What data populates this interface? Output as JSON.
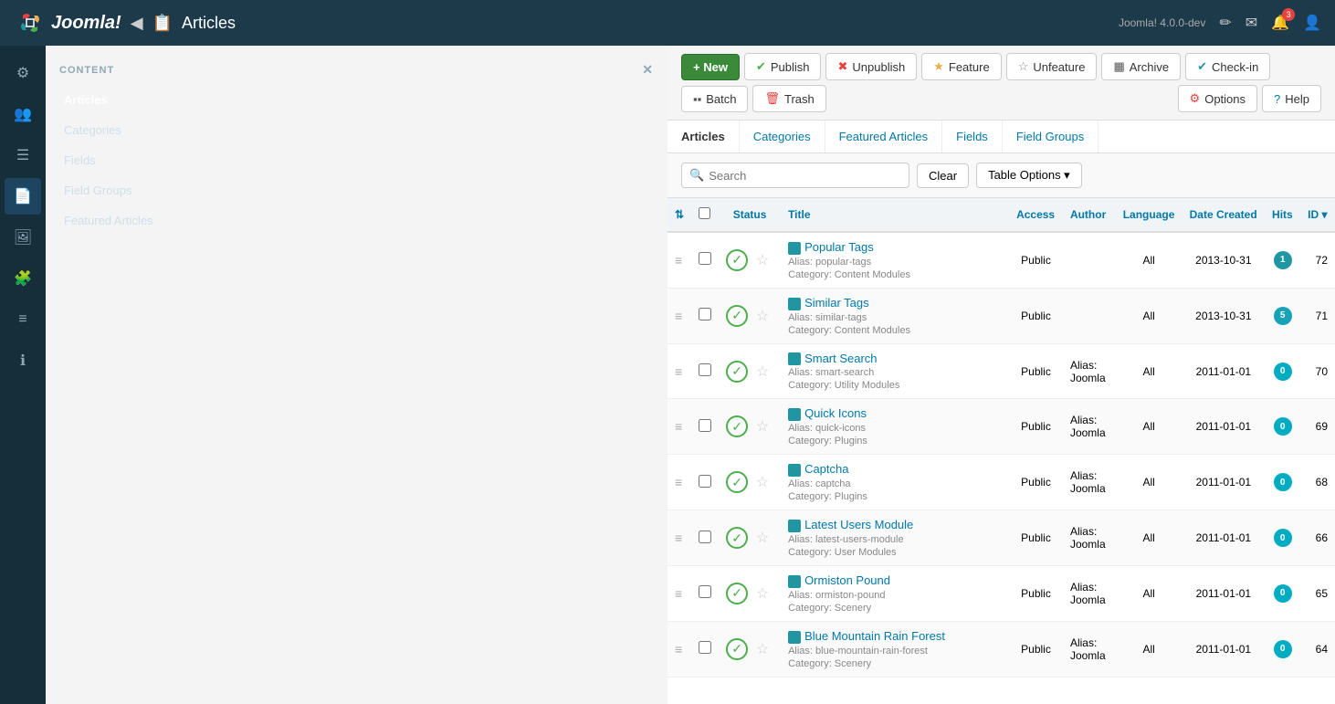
{
  "topbar": {
    "back_label": "◀",
    "page_icon": "📄",
    "title": "Articles",
    "version": "Joomla! 4.0.0-dev",
    "icons": [
      {
        "name": "edit-icon",
        "symbol": "✏"
      },
      {
        "name": "mail-icon",
        "symbol": "✉"
      },
      {
        "name": "bell-icon",
        "symbol": "🔔",
        "badge": "3"
      },
      {
        "name": "user-icon",
        "symbol": "👤"
      }
    ]
  },
  "toolbar": {
    "new_label": "+ New",
    "buttons": [
      {
        "name": "publish-button",
        "icon": "✔",
        "icon_color": "#4cae4c",
        "label": "Publish"
      },
      {
        "name": "unpublish-button",
        "icon": "✖",
        "icon_color": "#e84141",
        "label": "Unpublish"
      },
      {
        "name": "feature-button",
        "icon": "★",
        "icon_color": "#f0ad4e",
        "label": "Feature"
      },
      {
        "name": "unfeature-button",
        "icon": "☆",
        "icon_color": "#888",
        "label": "Unfeature"
      },
      {
        "name": "archive-button",
        "icon": "▦",
        "icon_color": "#888",
        "label": "Archive"
      },
      {
        "name": "checkin-button",
        "icon": "✔",
        "icon_color": "#2196a3",
        "label": "Check-in"
      },
      {
        "name": "batch-button",
        "icon": "▪",
        "icon_color": "#888",
        "label": "Batch"
      },
      {
        "name": "trash-button",
        "icon": "🗑",
        "icon_color": "#e84141",
        "label": "Trash"
      }
    ],
    "options_label": "Options",
    "help_label": "Help"
  },
  "subnav": {
    "items": [
      {
        "name": "articles-link",
        "label": "Articles",
        "active": true
      },
      {
        "name": "categories-link",
        "label": "Categories"
      },
      {
        "name": "featured-articles-link",
        "label": "Featured Articles"
      },
      {
        "name": "fields-link",
        "label": "Fields"
      },
      {
        "name": "field-groups-link",
        "label": "Field Groups"
      }
    ]
  },
  "search": {
    "placeholder": "Search",
    "clear_label": "Clear",
    "table_options_label": "Table Options ▾"
  },
  "table": {
    "headers": [
      {
        "name": "th-sort",
        "label": "⇅"
      },
      {
        "name": "th-checkbox",
        "label": ""
      },
      {
        "name": "th-status",
        "label": "Status"
      },
      {
        "name": "th-title",
        "label": "Title"
      },
      {
        "name": "th-access",
        "label": "Access"
      },
      {
        "name": "th-author",
        "label": "Author"
      },
      {
        "name": "th-language",
        "label": "Language"
      },
      {
        "name": "th-date",
        "label": "Date Created"
      },
      {
        "name": "th-hits",
        "label": "Hits"
      },
      {
        "name": "th-id",
        "label": "ID ▾"
      }
    ],
    "rows": [
      {
        "id": 72,
        "title": "Popular Tags",
        "alias": "popular-tags",
        "category": "Content Modules",
        "access": "Public",
        "author": "",
        "language": "All",
        "date": "2013-10-31",
        "hits": "1",
        "hits_color": "blue",
        "status": "published",
        "featured": false
      },
      {
        "id": 71,
        "title": "Similar Tags",
        "alias": "similar-tags",
        "category": "Content Modules",
        "access": "Public",
        "author": "",
        "language": "All",
        "date": "2013-10-31",
        "hits": "5",
        "hits_color": "teal",
        "status": "published",
        "featured": false
      },
      {
        "id": 70,
        "title": "Smart Search",
        "alias": "smart-search",
        "category": "Utility Modules",
        "access": "Public",
        "author": "Alias: Joomla",
        "language": "All",
        "date": "2011-01-01",
        "hits": "0",
        "hits_color": "cyan",
        "status": "published",
        "featured": false
      },
      {
        "id": 69,
        "title": "Quick Icons",
        "alias": "quick-icons",
        "category": "Plugins",
        "access": "Public",
        "author": "Alias: Joomla",
        "language": "All",
        "date": "2011-01-01",
        "hits": "0",
        "hits_color": "cyan",
        "status": "published",
        "featured": false
      },
      {
        "id": 68,
        "title": "Captcha",
        "alias": "captcha",
        "category": "Plugins",
        "access": "Public",
        "author": "Alias: Joomla",
        "language": "All",
        "date": "2011-01-01",
        "hits": "0",
        "hits_color": "cyan",
        "status": "published",
        "featured": false
      },
      {
        "id": 66,
        "title": "Latest Users Module",
        "alias": "latest-users-module",
        "category": "User Modules",
        "access": "Public",
        "author": "Alias: Joomla",
        "language": "All",
        "date": "2011-01-01",
        "hits": "0",
        "hits_color": "cyan",
        "status": "published",
        "featured": false
      },
      {
        "id": 65,
        "title": "Ormiston Pound",
        "alias": "ormiston-pound",
        "category": "Scenery",
        "access": "Public",
        "author": "Alias: Joomla",
        "language": "All",
        "date": "2011-01-01",
        "hits": "0",
        "hits_color": "cyan",
        "status": "published",
        "featured": false
      },
      {
        "id": 64,
        "title": "Blue Mountain Rain Forest",
        "alias": "blue-mountain-rain-forest",
        "category": "Scenery",
        "access": "Public",
        "author": "Alias: Joomla",
        "language": "All",
        "date": "2011-01-01",
        "hits": "0",
        "hits_color": "cyan",
        "status": "published",
        "featured": false
      }
    ]
  },
  "sidebar": {
    "section_label": "CONTENT",
    "items": [
      {
        "name": "articles-item",
        "label": "Articles",
        "active": true
      },
      {
        "name": "categories-item",
        "label": "Categories"
      },
      {
        "name": "fields-item",
        "label": "Fields"
      },
      {
        "name": "field-groups-item",
        "label": "Field Groups"
      },
      {
        "name": "featured-articles-item",
        "label": "Featured Articles"
      }
    ],
    "icons": [
      {
        "name": "gear-icon",
        "symbol": "⚙"
      },
      {
        "name": "users-icon",
        "symbol": "👥"
      },
      {
        "name": "list-icon",
        "symbol": "☰"
      },
      {
        "name": "content-icon",
        "symbol": "📄",
        "active": true
      },
      {
        "name": "image-icon",
        "symbol": "🖼"
      },
      {
        "name": "puzzle-icon",
        "symbol": "🧩"
      },
      {
        "name": "menu-icon",
        "symbol": "☰"
      },
      {
        "name": "info-icon",
        "symbol": "ℹ"
      }
    ]
  },
  "logo": {
    "text": "Joomla!"
  }
}
